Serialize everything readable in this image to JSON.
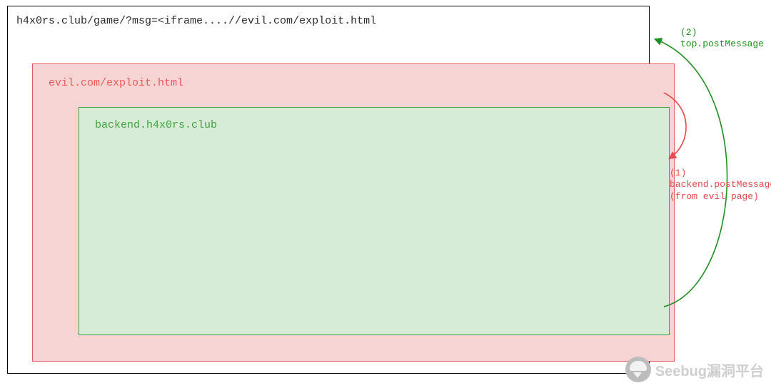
{
  "outer": {
    "url": "h4x0rs.club/game/?msg=<iframe....//evil.com/exploit.html"
  },
  "evil": {
    "url": "evil.com/exploit.html"
  },
  "backend": {
    "url": "backend.h4x0rs.club"
  },
  "annotations": {
    "step2_line1": "(2)",
    "step2_line2": "top.postMessage",
    "step1_line1": "(1)",
    "step1_line2": "backend.postMessage",
    "step1_line3": "(from evil page)"
  },
  "watermark": {
    "text": "Seebug漏洞平台"
  }
}
